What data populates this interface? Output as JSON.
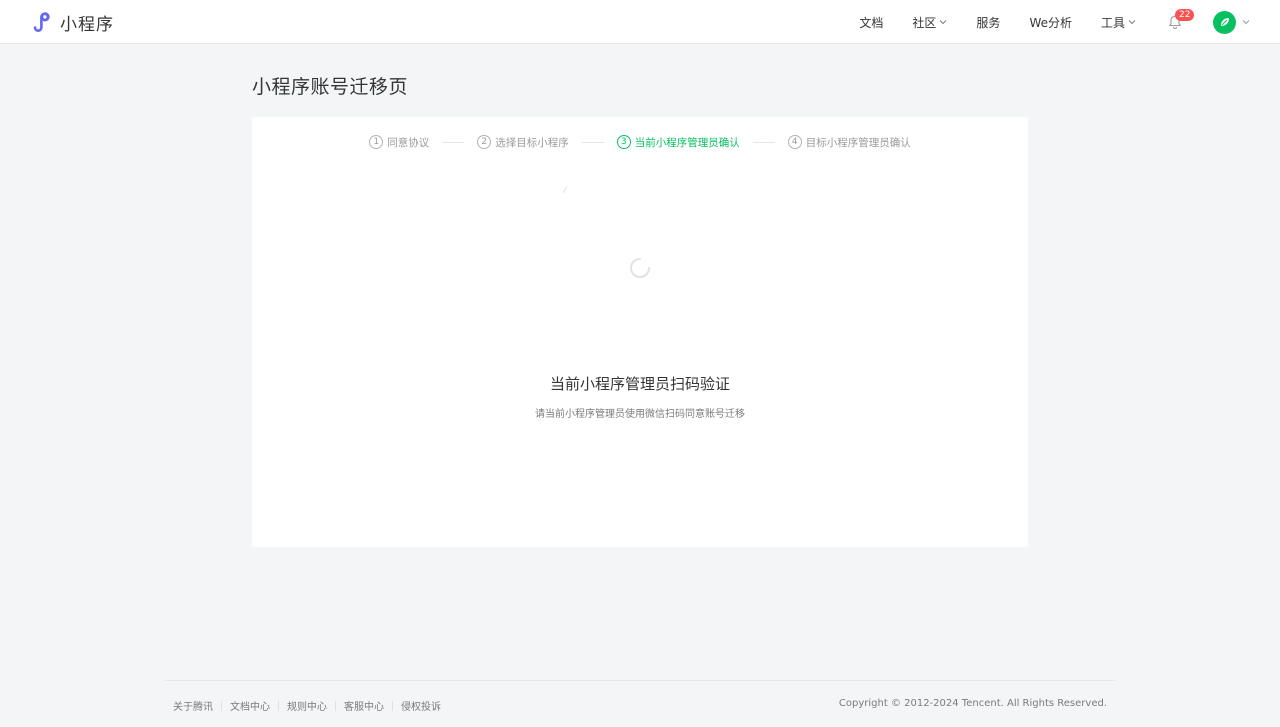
{
  "header": {
    "logo_text": "小程序",
    "nav": {
      "docs": "文档",
      "community": "社区",
      "service": "服务",
      "we_analysis": "We分析",
      "tools": "工具"
    },
    "notification_count": "22"
  },
  "page": {
    "title": "小程序账号迁移页"
  },
  "steps": [
    {
      "num": "1",
      "label": "同意协议"
    },
    {
      "num": "2",
      "label": "选择目标小程序"
    },
    {
      "num": "3",
      "label": "当前小程序管理员确认"
    },
    {
      "num": "4",
      "label": "目标小程序管理员确认"
    }
  ],
  "active_step": 3,
  "verify": {
    "title": "当前小程序管理员扫码验证",
    "subtitle": "请当前小程序管理员使用微信扫码同意账号迁移"
  },
  "footer": {
    "links": [
      "关于腾讯",
      "文档中心",
      "规则中心",
      "客服中心",
      "侵权投诉"
    ],
    "copyright": "Copyright © 2012-2024 Tencent. All Rights Reserved."
  },
  "colors": {
    "accent": "#07c160",
    "badge": "#fa5151",
    "logo": "#6467f0"
  }
}
